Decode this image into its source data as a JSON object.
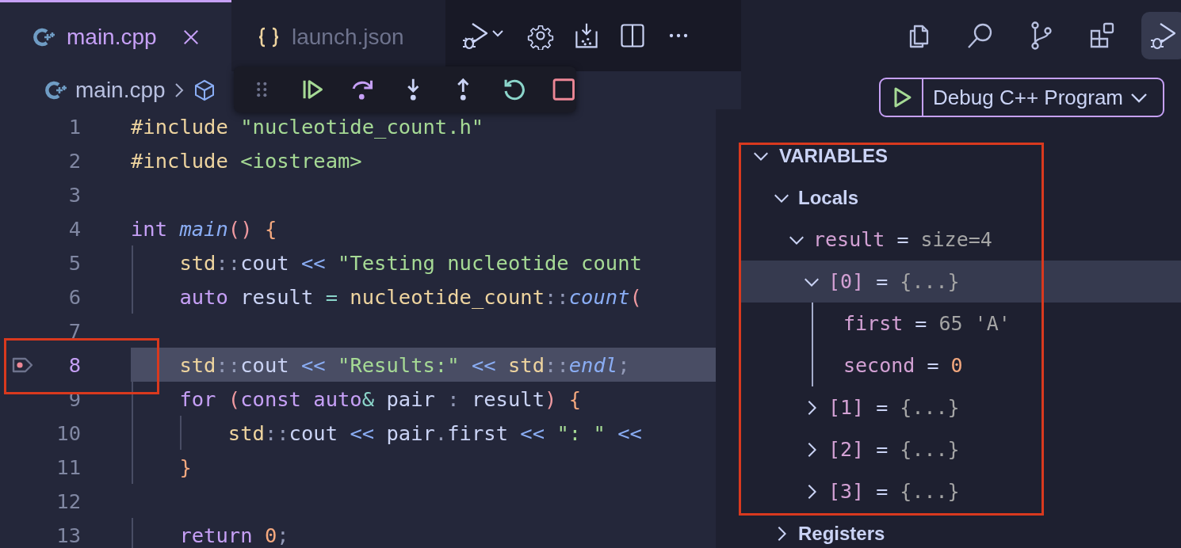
{
  "editor_tabs": [
    {
      "kind": "cpp",
      "label": "main.cpp",
      "selected": true
    },
    {
      "kind": "json",
      "label": "launch.json",
      "selected": false
    }
  ],
  "breadcrumb": {
    "file": "main.cpp"
  },
  "code_lines": [
    {
      "number": "1",
      "current": false,
      "breakpoint": false,
      "tokens": [
        {
          "kind": "pre",
          "text": "#include"
        },
        {
          "kind": "str",
          "text": " \"nucleotide_count.h\""
        }
      ]
    },
    {
      "number": "2",
      "current": false,
      "breakpoint": false,
      "tokens": [
        {
          "kind": "pre",
          "text": "#include"
        },
        {
          "kind": "str",
          "text": " <iostream>"
        }
      ]
    },
    {
      "number": "3",
      "current": false,
      "breakpoint": false
    },
    {
      "number": "4",
      "current": false,
      "breakpoint": false,
      "tokens": [
        {
          "kind": "kw",
          "text": "int"
        },
        {
          "kind": "fn",
          "text": " main"
        },
        {
          "kind": "paren",
          "text": "()"
        },
        {
          "kind": "brace",
          "text": " {"
        }
      ]
    },
    {
      "number": "5",
      "current": false,
      "breakpoint": false,
      "tokens": [
        {
          "kind": "ns",
          "text": "    std"
        },
        {
          "kind": "punct",
          "text": "::"
        },
        {
          "kind": "id",
          "text": "cout"
        },
        {
          "kind": "op",
          "text": " <<"
        },
        {
          "kind": "str",
          "text": " \"Testing nucleotide count"
        }
      ]
    },
    {
      "number": "6",
      "current": false,
      "breakpoint": false,
      "tokens": [
        {
          "kind": "kw",
          "text": "    auto"
        },
        {
          "kind": "id",
          "text": " result"
        },
        {
          "kind": "eq",
          "text": " ="
        },
        {
          "kind": "ns",
          "text": " nucleotide_count"
        },
        {
          "kind": "punct",
          "text": "::"
        },
        {
          "kind": "fn",
          "text": "count"
        },
        {
          "kind": "paren",
          "text": "("
        }
      ]
    },
    {
      "number": "7",
      "current": false,
      "breakpoint": false
    },
    {
      "number": "8",
      "current": true,
      "breakpoint": true,
      "tokens": [
        {
          "kind": "ns",
          "text": "    std"
        },
        {
          "kind": "punct",
          "text": "::"
        },
        {
          "kind": "id",
          "text": "cout"
        },
        {
          "kind": "op",
          "text": " <<"
        },
        {
          "kind": "str",
          "text": " \"Results:\""
        },
        {
          "kind": "op",
          "text": " <<"
        },
        {
          "kind": "ns",
          "text": " std"
        },
        {
          "kind": "punct",
          "text": "::"
        },
        {
          "kind": "fn",
          "text": "endl"
        },
        {
          "kind": "punct",
          "text": ";"
        }
      ]
    },
    {
      "number": "9",
      "current": false,
      "breakpoint": false,
      "tokens": [
        {
          "kind": "kw",
          "text": "    for"
        },
        {
          "kind": "paren",
          "text": " ("
        },
        {
          "kind": "kw",
          "text": "const"
        },
        {
          "kind": "kw",
          "text": " auto"
        },
        {
          "kind": "eq",
          "text": "&"
        },
        {
          "kind": "id",
          "text": " pair"
        },
        {
          "kind": "punct",
          "text": " :"
        },
        {
          "kind": "id",
          "text": " result"
        },
        {
          "kind": "paren",
          "text": ")"
        },
        {
          "kind": "brace",
          "text": " {"
        }
      ]
    },
    {
      "number": "10",
      "current": false,
      "breakpoint": false,
      "tokens": [
        {
          "kind": "ns",
          "text": "        std"
        },
        {
          "kind": "punct",
          "text": "::"
        },
        {
          "kind": "id",
          "text": "cout"
        },
        {
          "kind": "op",
          "text": " <<"
        },
        {
          "kind": "id",
          "text": " pair"
        },
        {
          "kind": "punct",
          "text": "."
        },
        {
          "kind": "id",
          "text": "first"
        },
        {
          "kind": "op",
          "text": " <<"
        },
        {
          "kind": "str",
          "text": " \": \""
        },
        {
          "kind": "op",
          "text": " <<"
        }
      ]
    },
    {
      "number": "11",
      "current": false,
      "breakpoint": false,
      "tokens": [
        {
          "kind": "brace",
          "text": "    }"
        }
      ]
    },
    {
      "number": "12",
      "current": false,
      "breakpoint": false
    },
    {
      "number": "13",
      "current": false,
      "breakpoint": false,
      "tokens": [
        {
          "kind": "kw",
          "text": "    return"
        },
        {
          "kind": "num",
          "text": " 0"
        },
        {
          "kind": "punct",
          "text": ";"
        }
      ]
    }
  ],
  "activity_bar": [
    {
      "kind": "files",
      "selected": false
    },
    {
      "kind": "search",
      "selected": false
    },
    {
      "kind": "source-control",
      "selected": false
    },
    {
      "kind": "extensions",
      "selected": false
    },
    {
      "kind": "run-debug",
      "selected": true
    }
  ],
  "run_config": {
    "label": "Debug C++ Program"
  },
  "sections": [
    {
      "title": "VARIABLES",
      "expanded": true,
      "children": [
        {
          "label": "Locals",
          "expanded": true,
          "children": [
            {
              "name": "result",
              "operator": "=",
              "value": "size=4",
              "kind": "text",
              "expanded": true,
              "selected": false,
              "children": [
                {
                  "name": "[0]",
                  "operator": "=",
                  "value": "{...}",
                  "kind": "text",
                  "expanded": true,
                  "selected": true,
                  "children": [
                    {
                      "name": "first",
                      "operator": "=",
                      "value": "65 'A'",
                      "kind": "text",
                      "selected": false
                    },
                    {
                      "name": "second",
                      "operator": "=",
                      "value": "0",
                      "kind": "number",
                      "selected": false
                    }
                  ]
                },
                {
                  "name": "[1]",
                  "operator": "=",
                  "value": "{...}",
                  "kind": "text",
                  "expanded": false,
                  "selected": false
                },
                {
                  "name": "[2]",
                  "operator": "=",
                  "value": "{...}",
                  "kind": "text",
                  "expanded": false,
                  "selected": false
                },
                {
                  "name": "[3]",
                  "operator": "=",
                  "value": "{...}",
                  "kind": "text",
                  "expanded": false,
                  "selected": false
                }
              ]
            }
          ]
        },
        {
          "label": "Registers",
          "expanded": false
        }
      ]
    }
  ]
}
